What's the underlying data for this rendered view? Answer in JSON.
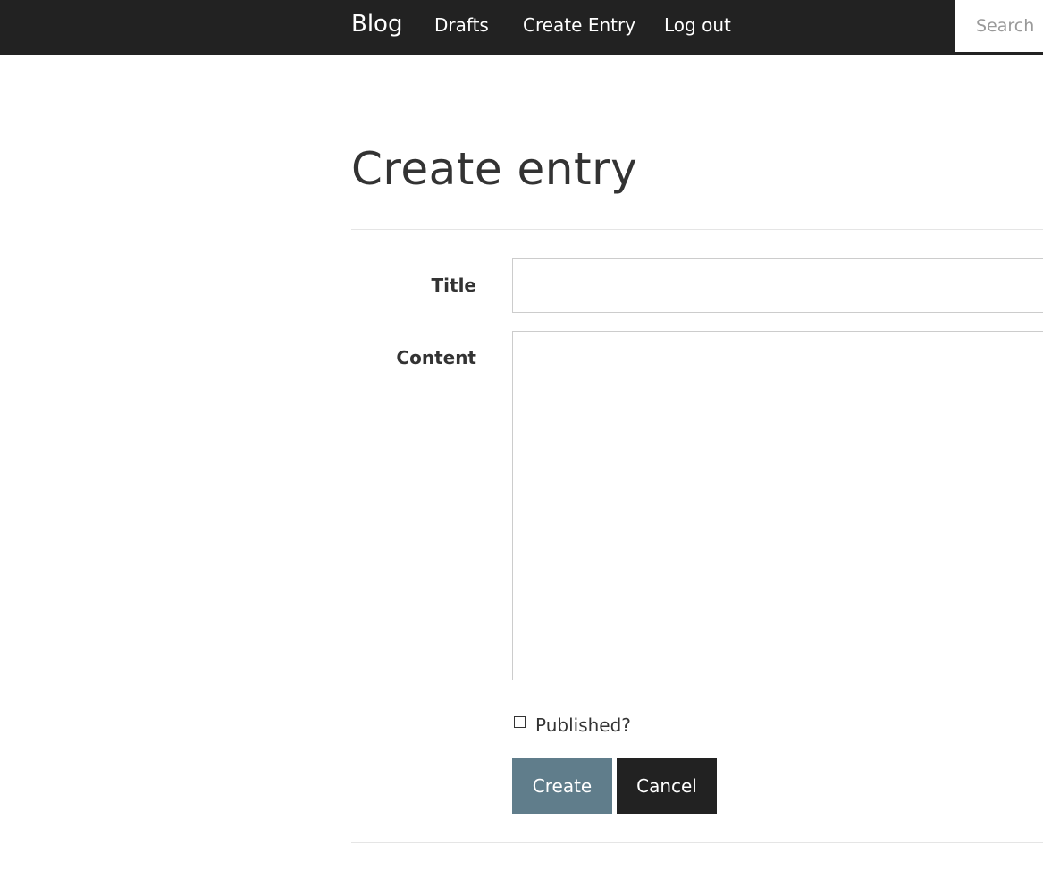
{
  "navbar": {
    "brand": "Blog",
    "links": [
      {
        "label": "Drafts"
      },
      {
        "label": "Create Entry"
      },
      {
        "label": "Log out"
      }
    ],
    "search": {
      "placeholder": "Search",
      "value": ""
    }
  },
  "page": {
    "title": "Create entry"
  },
  "form": {
    "title_label": "Title",
    "title_value": "",
    "content_label": "Content",
    "content_value": "",
    "published_label": "Published?",
    "published_checked": false,
    "create_label": "Create",
    "cancel_label": "Cancel"
  },
  "colors": {
    "navbar_bg": "#222222",
    "create_button": "#607d8b",
    "cancel_button": "#222222"
  }
}
